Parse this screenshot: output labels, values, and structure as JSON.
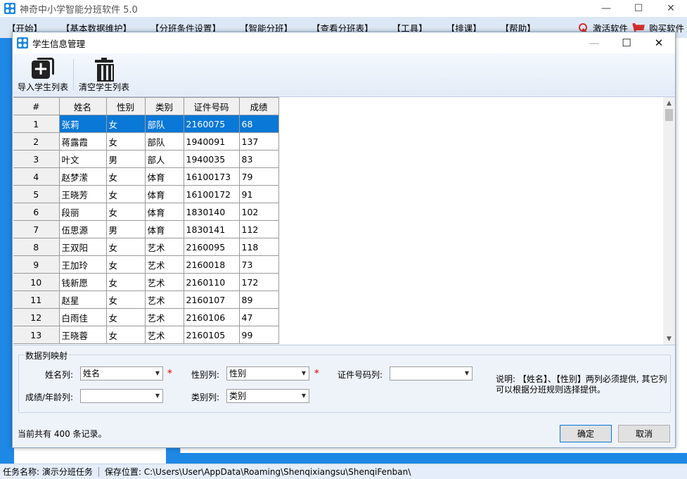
{
  "app": {
    "title": "神奇中小学智能分班软件 5.0",
    "menu": [
      "【开始】",
      "【基本数据维护】",
      "【分班条件设置】",
      "【智能分班】",
      "【查看分班表】",
      "【工具】",
      "【排课】",
      "【帮助】"
    ],
    "activate_label": "激活软件",
    "buy_label": "购买软件",
    "status": {
      "task_label": "任务名称: 演示分班任务",
      "path_label": "保存位置: C:\\Users\\User\\AppData\\Roaming\\Shenqixiangsu\\ShenqiFenban\\"
    },
    "controls": {
      "minimize": "—",
      "maximize": "☐",
      "close": "✕"
    }
  },
  "dialog": {
    "title": "学生信息管理",
    "controls": {
      "minimize": "—",
      "maximize": "☐",
      "close": "✕"
    },
    "toolbar": {
      "import_label": "导入学生列表",
      "clear_label": "清空学生列表"
    },
    "grid": {
      "columns": [
        "#",
        "姓名",
        "性别",
        "类别",
        "证件号码",
        "成绩"
      ],
      "rows": [
        [
          "1",
          "张莉",
          "女",
          "部队",
          "2160075",
          "68"
        ],
        [
          "2",
          "蒋露霞",
          "女",
          "部队",
          "1940091",
          "137"
        ],
        [
          "3",
          "叶文",
          "男",
          "部人",
          "1940035",
          "83"
        ],
        [
          "4",
          "赵梦潆",
          "女",
          "体育",
          "16100173",
          "79"
        ],
        [
          "5",
          "王晓芳",
          "女",
          "体育",
          "16100172",
          "91"
        ],
        [
          "6",
          "段丽",
          "女",
          "体育",
          "1830140",
          "102"
        ],
        [
          "7",
          "伍思源",
          "男",
          "体育",
          "1830141",
          "112"
        ],
        [
          "8",
          "王双阳",
          "女",
          "艺术",
          "2160095",
          "118"
        ],
        [
          "9",
          "王加玲",
          "女",
          "艺术",
          "2160018",
          "73"
        ],
        [
          "10",
          "钱新愿",
          "女",
          "艺术",
          "2160110",
          "172"
        ],
        [
          "11",
          "赵星",
          "女",
          "艺术",
          "2160107",
          "89"
        ],
        [
          "12",
          "白雨佳",
          "女",
          "艺术",
          "2160106",
          "47"
        ],
        [
          "13",
          "王晓蓉",
          "女",
          "艺术",
          "2160105",
          "99"
        ]
      ],
      "selected_row": 0
    },
    "mapping": {
      "group_title": "数据列映射",
      "name_label": "姓名列:",
      "name_value": "姓名",
      "gender_label": "性别列:",
      "gender_value": "性别",
      "id_label": "证件号码列:",
      "id_value": "",
      "score_label": "成绩/年龄列:",
      "score_value": "",
      "category_label": "类别列:",
      "category_value": "类别",
      "required_mark": "*",
      "note": "说明: 【姓名】、【性别】两列必须提供, 其它列可以根据分班规则选择提供。"
    },
    "record_count": "当前共有 400 条记录。",
    "ok_label": "确定",
    "cancel_label": "取消"
  },
  "colors": {
    "accent": "#1e88e5",
    "selection": "#0a78d7",
    "required": "#e53935",
    "menubar": "#dde8f6"
  }
}
